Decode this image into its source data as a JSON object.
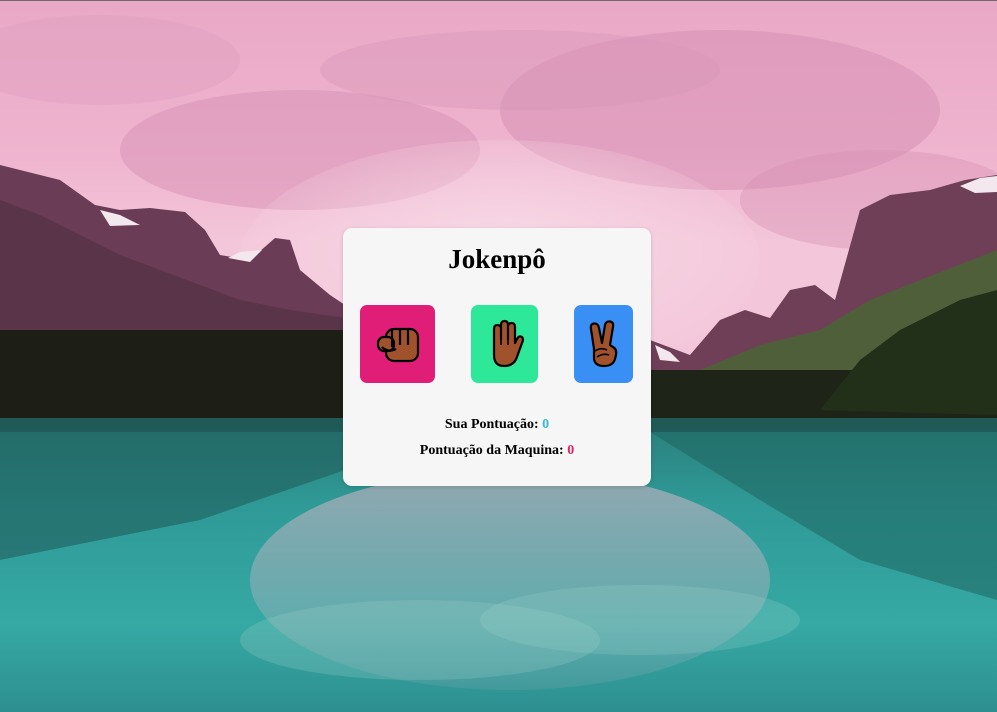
{
  "page": {
    "background": "mountain-lake-landscape"
  },
  "game": {
    "title": "Jokenpô",
    "choices": [
      {
        "name": "rock",
        "icon": "fist-icon",
        "color": "#e01e78"
      },
      {
        "name": "paper",
        "icon": "raised-hand-icon",
        "color": "#2ee89a"
      },
      {
        "name": "scissors",
        "icon": "victory-hand-icon",
        "color": "#3a8ff5"
      }
    ],
    "player_score_label": "Sua Pontuação:",
    "player_score": "0",
    "player_score_color": "#31bbd6",
    "machine_score_label": "Pontuação da Maquina:",
    "machine_score": "0",
    "machine_score_color": "#e0245e"
  }
}
